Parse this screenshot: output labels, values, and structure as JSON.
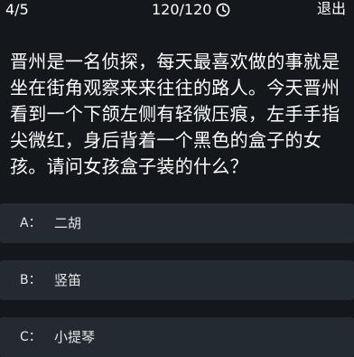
{
  "header": {
    "progress": "4/5",
    "timer": "120/120",
    "exit_label": "退出"
  },
  "question": {
    "text": "晋州是一名侦探，每天最喜欢做的事就是坐在街角观察来来往往的路人。今天晋州看到一个下颌左侧有轻微压痕，左手手指尖微红，身后背着一个黑色的盒子的女孩。请问女孩盒子装的什么？"
  },
  "options": [
    {
      "letter": "A：",
      "text": "二胡"
    },
    {
      "letter": "B：",
      "text": "竖笛"
    },
    {
      "letter": "C：",
      "text": "小提琴"
    }
  ],
  "icons": {
    "timer": "clock-icon"
  },
  "colors": {
    "background": "#14181c",
    "option_background": "#232a31",
    "text": "#ffffff"
  }
}
